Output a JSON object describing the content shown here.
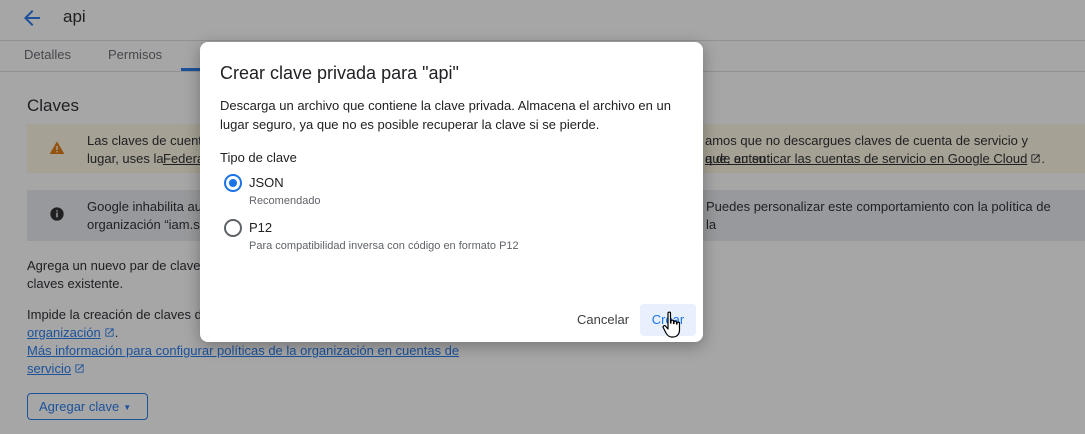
{
  "header": {
    "title": "api"
  },
  "tabs": [
    {
      "label": "Detalles"
    },
    {
      "label": "Permisos"
    }
  ],
  "section": {
    "title": "Claves"
  },
  "warning_banner": {
    "line1_start": "Las claves de cuent",
    "line1_end": "amos que no descargues claves de cuenta de servicio y que, en su",
    "line2_start": "lugar, uses la ",
    "line2_link_start": "Federa",
    "line2_link_end": "a de autenticar las cuentas de servicio en Google Cloud",
    "line2_tail": "."
  },
  "info_banner": {
    "line1_start": "Google inhabilita au",
    "line1_end": "Puedes personalizar este comportamiento con la política de la",
    "line2_start": "organización “iam.s"
  },
  "body": {
    "para1_line1": "Agrega un nuevo par de claves",
    "para1_line2": "claves existente.",
    "para2_line1": "Impide la creación de claves de",
    "para2_link1": "organización",
    "para2_after_link": ".",
    "link2_line1": "Más información para configurar políticas de la organización en cuentas de",
    "link2_line2": "servicio"
  },
  "add_key_button": {
    "label": "Agregar clave"
  },
  "dialog": {
    "title": "Crear clave privada para \"api\"",
    "description": "Descarga un archivo que contiene la clave privada. Almacena el archivo en un lugar seguro, ya que no es posible recuperar la clave si se pierde.",
    "key_type_label": "Tipo de clave",
    "options": [
      {
        "label": "JSON",
        "sub": "Recomendado",
        "selected": true
      },
      {
        "label": "P12",
        "sub": "Para compatibilidad inversa con código en formato P12",
        "selected": false
      }
    ],
    "cancel_label": "Cancelar",
    "create_label": "Crear"
  },
  "colors": {
    "accent": "#1a73e8",
    "warning_bg": "#fef7e0",
    "info_bg": "#e8eaed",
    "warning_icon": "#e37400"
  }
}
